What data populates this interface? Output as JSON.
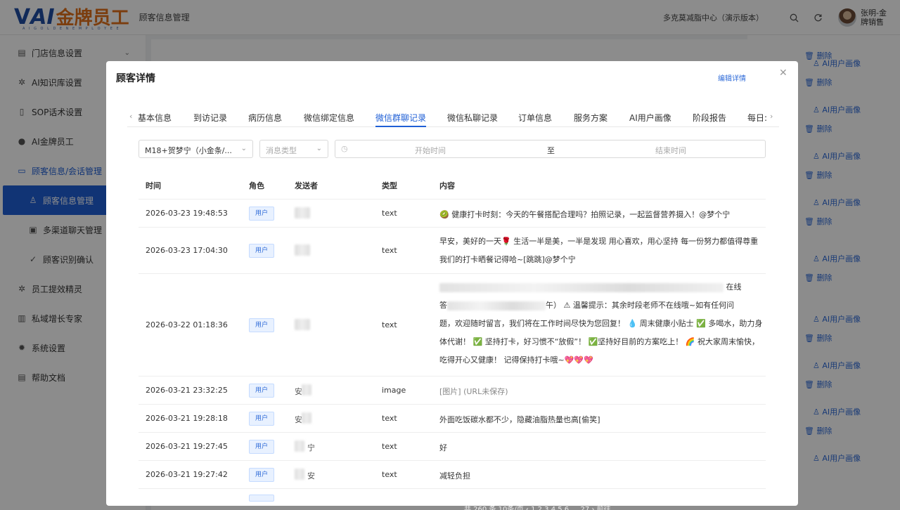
{
  "header": {
    "logo_v": "V",
    "logo_ai": "AI",
    "logo_cn": "金牌员工",
    "logo_sub": "A I   G O L D E N   E M P L O Y E E",
    "page_caption": "顾客信息管理",
    "store_name": "多克莫减脂中心（演示版本）",
    "user_name": "张明-金牌销售",
    "icons": [
      "search-icon",
      "refresh-icon"
    ]
  },
  "sidebar": {
    "items": [
      {
        "label": "门店信息设置",
        "icon": "store-icon"
      },
      {
        "label": "AI知识库设置",
        "icon": "sparkle-icon"
      },
      {
        "label": "SOP话术设置",
        "icon": "phone-icon"
      },
      {
        "label": "AI金牌员工",
        "icon": "user-icon"
      },
      {
        "label": "顾客信息/会话管理",
        "icon": "folder-icon"
      },
      {
        "label": "顾客信息管理",
        "icon": "person-icon"
      },
      {
        "label": "多渠道聊天管理",
        "icon": "chat-icon"
      },
      {
        "label": "顾客识别确认",
        "icon": "check-icon"
      },
      {
        "label": "员工提效精灵",
        "icon": "sparkle-icon"
      },
      {
        "label": "私域增长专家",
        "icon": "book-icon"
      },
      {
        "label": "系统设置",
        "icon": "gear-icon"
      },
      {
        "label": "帮助文档",
        "icon": "doc-icon"
      }
    ]
  },
  "background": {
    "portrait_label": "AI用户画像",
    "delete_label": "删除",
    "pager": "共 260 条      10条/页      ‹   1   2   3   4   5   6   …   27   ›      前往"
  },
  "modal": {
    "title": "顾客详情",
    "edit_link": "编辑详情",
    "tabs": [
      "基本信息",
      "到访记录",
      "病历信息",
      "微信绑定信息",
      "微信群聊记录",
      "微信私聊记录",
      "订单信息",
      "服务方案",
      "AI用户画像",
      "阶段报告",
      "每日:"
    ],
    "active_tab": "微信群聊记录",
    "filters": {
      "group": "M18+贺梦宁（小金条/...",
      "msg_type_placeholder": "消息类型",
      "start_placeholder": "开始时间",
      "to": "至",
      "end_placeholder": "结束时间"
    },
    "columns": [
      "时间",
      "角色",
      "发送者",
      "类型",
      "内容"
    ],
    "rows": [
      {
        "time": "2026-03-23 19:48:53",
        "role": "用户",
        "sender": "",
        "type": "text",
        "content": "🥝 健康打卡时刻：今天的午餐搭配合理吗？拍照记录，一起监督营养摄入！@梦个宁"
      },
      {
        "time": "2026-03-23 17:04:30",
        "role": "用户",
        "sender": "",
        "type": "text",
        "content": "早安，美好的一天🌹 生活一半是美，一半是发现 用心喜欢，用心坚持 每一份努力都值得尊重 我们的打卡晒餐记得哈~[跳跳]@梦个宁"
      },
      {
        "time": "2026-03-22 01:18:36",
        "role": "用户",
        "sender": "",
        "type": "text",
        "content_line1_tail": "在线",
        "content_line2_head": "答",
        "content_line2_tail": "午）  ⚠ 温馨提示：其余时段老师不在线哦~如有任何问",
        "content_rest": "题，欢迎随时留言，我们将在工作时间尽快为您回复！ 💧 周末健康小贴士 ✅ 多喝水，助力身体代谢！ ✅ 坚持打卡，好习惯不“放假”！ ✅坚持好目前的方案吃上！ 🌈 祝大家周末愉快，吃得开心又健康！ 记得保持打卡哦~💖💖💖"
      },
      {
        "time": "2026-03-21 23:32:25",
        "role": "用户",
        "sender": "安",
        "type": "image",
        "content": "[图片] (URL未保存)"
      },
      {
        "time": "2026-03-21 19:28:18",
        "role": "用户",
        "sender": "安",
        "type": "text",
        "content": "外面吃饭碳水都不少，隐藏油脂热量也高[偷笑]"
      },
      {
        "time": "2026-03-21 19:27:45",
        "role": "用户",
        "sender": "宁",
        "type": "text",
        "content": "好"
      },
      {
        "time": "2026-03-21 19:27:42",
        "role": "用户",
        "sender": "安",
        "type": "text",
        "content": "减轻负担"
      }
    ]
  }
}
